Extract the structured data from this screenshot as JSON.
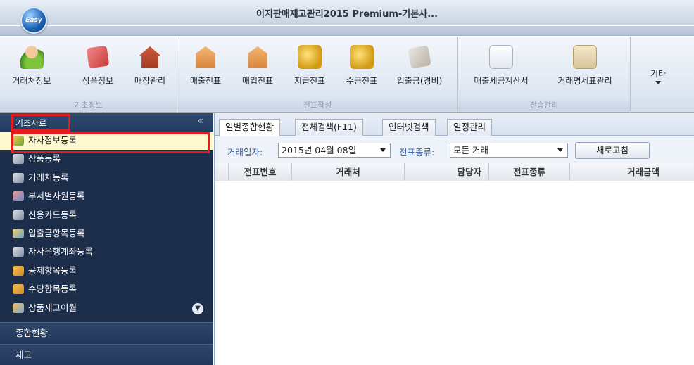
{
  "window": {
    "title": "이지판매재고관리2015 Premium-기본사...",
    "logo_text": "Easy"
  },
  "ribbon": {
    "groups": [
      {
        "label": "기초정보",
        "buttons": [
          "거래처정보",
          "상품정보",
          "매장관리"
        ]
      },
      {
        "label": "전표작성",
        "buttons": [
          "매출전표",
          "매입전표",
          "지급전표",
          "수금전표",
          "입출금(경비)"
        ]
      },
      {
        "label": "전송관리",
        "buttons": [
          "매출세금계산서",
          "거래명세표관리"
        ]
      },
      {
        "label": "",
        "buttons": [
          "기타"
        ]
      }
    ]
  },
  "sidebar": {
    "header": "기초자료",
    "collapse_glyph": "«",
    "items": [
      {
        "label": "자사정보등록",
        "icon": "user-key-icon",
        "active": true
      },
      {
        "label": "상품등록",
        "icon": "box-icon"
      },
      {
        "label": "거래처등록",
        "icon": "partner-icon"
      },
      {
        "label": "부서별사원등록",
        "icon": "staff-icon"
      },
      {
        "label": "신용카드등록",
        "icon": "credit-card-icon"
      },
      {
        "label": "입출금항목등록",
        "icon": "cash-flow-icon"
      },
      {
        "label": "자사은행계좌등록",
        "icon": "bank-icon"
      },
      {
        "label": "공제항목등록",
        "icon": "deduction-icon"
      },
      {
        "label": "수당항목등록",
        "icon": "allowance-icon"
      },
      {
        "label": "상품재고이월",
        "icon": "stock-carry-icon"
      }
    ],
    "sections": [
      "종합현황",
      "재고"
    ],
    "colors": {
      "bg": "#1d2e4b",
      "active_bg": "#fff9cf",
      "highlight": "#e61b1b"
    }
  },
  "main": {
    "tabs": [
      "일별종합현황",
      "전체검색(F11)",
      "인터넷검색",
      "일정관리"
    ],
    "filters": {
      "date_label": "거래일자:",
      "date_value": "2015년 04월 08일",
      "type_label": "전표종류:",
      "type_value": "모든 거래",
      "refresh_label": "새로고침"
    },
    "columns": [
      "전표번호",
      "거래처",
      "담당자",
      "전표종류",
      "거래금액"
    ]
  }
}
